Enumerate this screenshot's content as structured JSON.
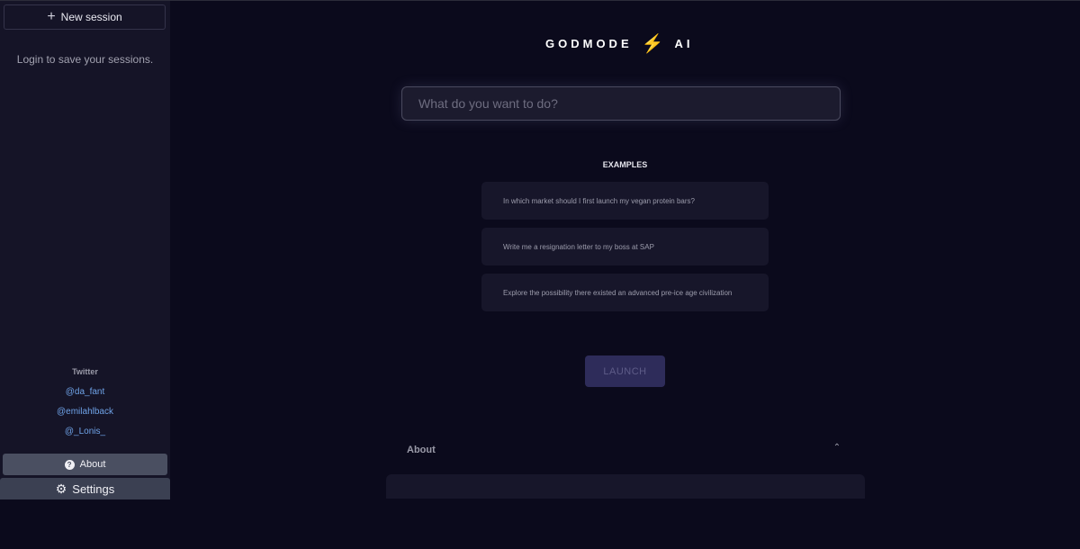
{
  "sidebar": {
    "new_session_label": "New session",
    "login_note": "Login to save your sessions.",
    "twitter_heading": "Twitter",
    "twitter_links": [
      "@da_fant",
      "@emilahlback",
      "@_Lonis_"
    ],
    "about_label": "About",
    "settings_label": "Settings"
  },
  "brand": {
    "left": "GODMODE",
    "right": "AI",
    "bolt_icon": "lightning-bolt-icon",
    "bolt_color": "#f3b61f"
  },
  "prompt": {
    "placeholder": "What do you want to do?",
    "value": ""
  },
  "examples": {
    "heading": "EXAMPLES",
    "items": [
      "In which market should I first launch my vegan protein bars?",
      "Write me a resignation letter to my boss at SAP",
      "Explore the possibility there existed an advanced pre-ice age civilization"
    ]
  },
  "launch_label": "LAUNCH",
  "about_section": {
    "title": "About"
  },
  "colors": {
    "background": "#0b0a1c",
    "sidebar": "#151427",
    "link": "#6fa3e8",
    "launch_button": "#2e2c5a"
  }
}
